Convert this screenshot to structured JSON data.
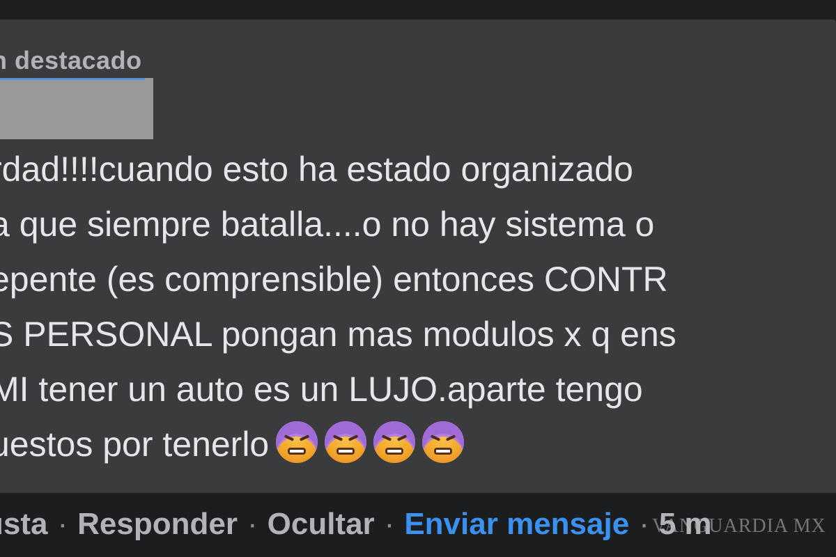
{
  "badge": "n destacado",
  "comment": {
    "lines": [
      "rdad!!!!cuando esto ha estado organizado",
      "a que siempre batalla....o no hay sistema o",
      "epente (es comprensible) entonces CONTR",
      "S PERSONAL pongan mas modulos x q ens",
      " MI tener un auto es un LUJO.aparte tengo",
      "uestos por tenerlo"
    ],
    "emoji_name": "dizzy-face-emoji",
    "emoji_count": 4
  },
  "actions": {
    "like": "usta",
    "reply": "Responder",
    "hide": "Ocultar",
    "message": "Enviar mensaje",
    "time": "5 m",
    "separator": "·"
  },
  "watermark": "VANGUARDIA MX",
  "colors": {
    "bubble": "#3a3b3d",
    "background": "#1c1d1f",
    "text": "#e4e6eb",
    "muted": "#b0b3b8",
    "link": "#3b91f0"
  }
}
